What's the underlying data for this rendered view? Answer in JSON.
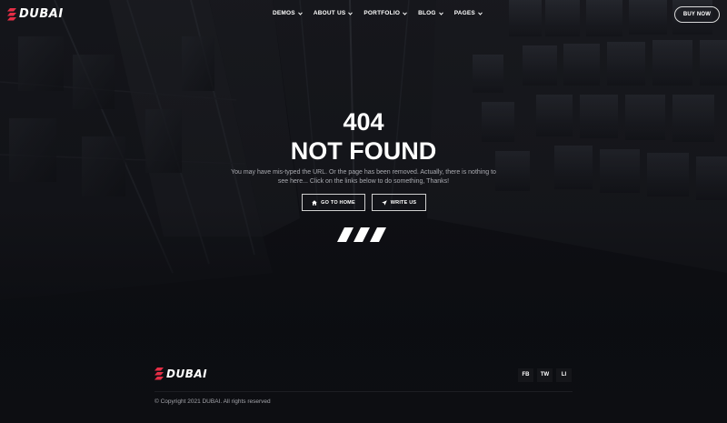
{
  "brand": {
    "name": "DUBAI",
    "accent": "#e52e46"
  },
  "nav": {
    "items": [
      {
        "label": "DEMOS"
      },
      {
        "label": "ABOUT US"
      },
      {
        "label": "PORTFOLIO"
      },
      {
        "label": "BLOG"
      },
      {
        "label": "PAGES"
      }
    ],
    "cta": "BUY NOW"
  },
  "hero": {
    "code": "404",
    "title": "NOT FOUND",
    "description": "You may have mis-typed the URL. Or the page has been removed. Actually, there is nothing to see here... Click on the links below to do something, Thanks!",
    "buttons": {
      "home": {
        "label": "GO TO HOME",
        "icon": "home-icon"
      },
      "write": {
        "label": "WRITE US",
        "icon": "paper-plane-icon"
      }
    }
  },
  "footer": {
    "brand": "DUBAI",
    "social": [
      {
        "label": "FB"
      },
      {
        "label": "TW"
      },
      {
        "label": "LI"
      }
    ],
    "copyright": "© Copyright 2021 DUBAI. All rights reserved"
  }
}
